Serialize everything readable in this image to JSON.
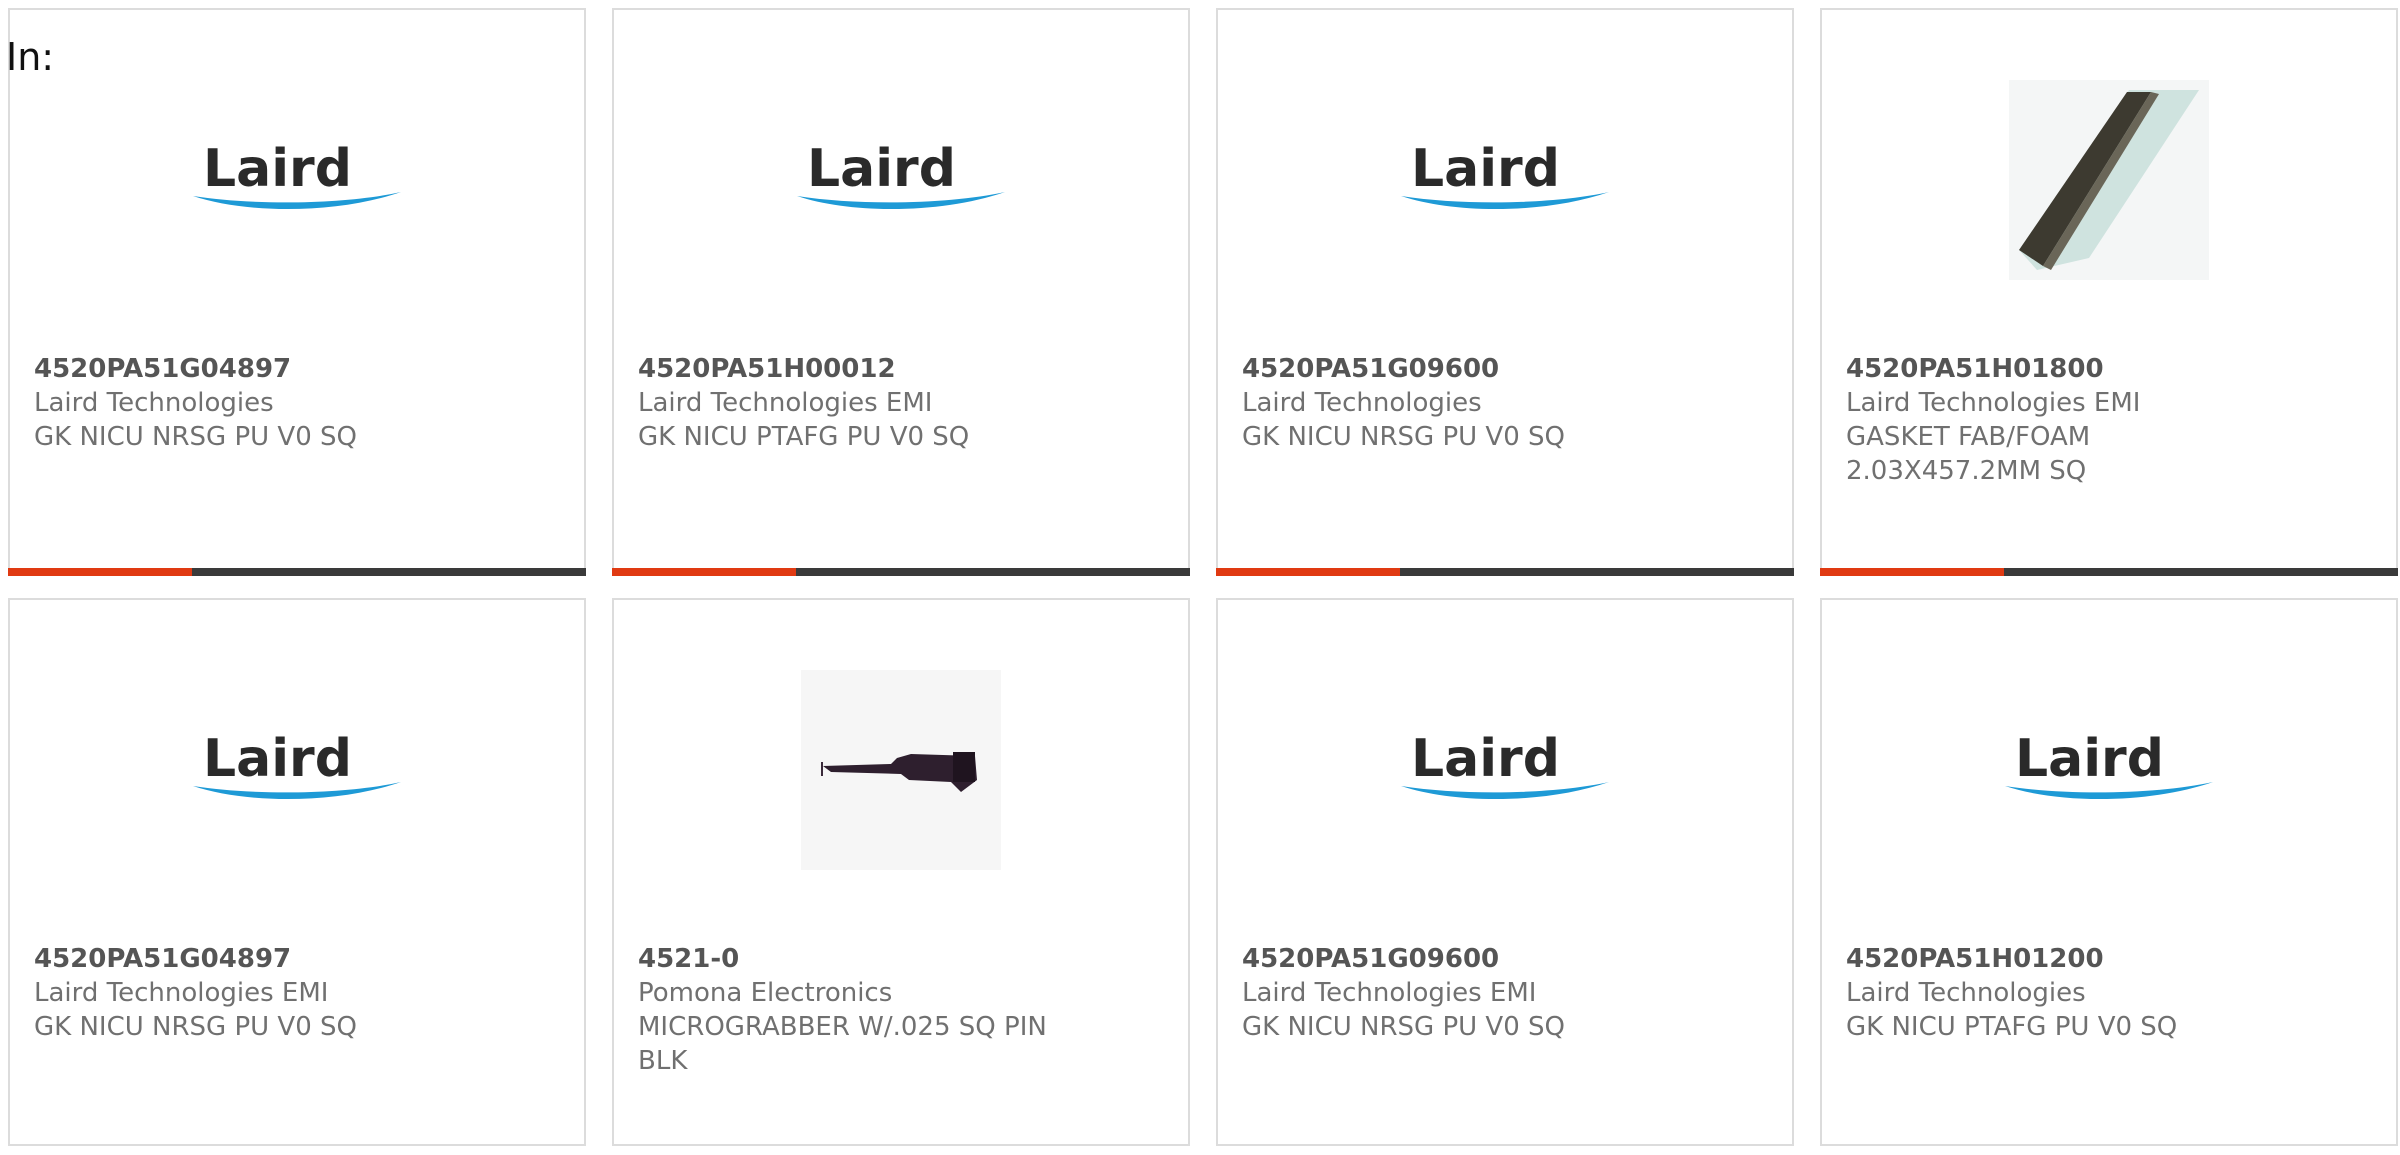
{
  "filter": {
    "label": "In:"
  },
  "colors": {
    "accent": "#e03a12",
    "bar_dark": "#3a3a3a",
    "laird_blue": "#1e9ad6"
  },
  "products": [
    {
      "part_number": "4520PA51G04897",
      "manufacturer": "Laird Technologies",
      "description": "GK NICU NRSG PU V0 SQ",
      "image": "laird-logo"
    },
    {
      "part_number": "4520PA51H00012",
      "manufacturer": "Laird Technologies EMI",
      "description": "GK NICU PTAFG PU V0 SQ",
      "image": "laird-logo"
    },
    {
      "part_number": "4520PA51G09600",
      "manufacturer": "Laird Technologies",
      "description": "GK NICU NRSG PU V0 SQ",
      "image": "laird-logo"
    },
    {
      "part_number": "4520PA51H01800",
      "manufacturer": "Laird Technologies EMI",
      "description": "GASKET FAB/FOAM 2.03X457.2MM SQ",
      "image": "gasket-photo"
    },
    {
      "part_number": "4520PA51G04897",
      "manufacturer": "Laird Technologies EMI",
      "description": "GK NICU NRSG PU V0 SQ",
      "image": "laird-logo"
    },
    {
      "part_number": "4521-0",
      "manufacturer": "Pomona Electronics",
      "description": "MICROGRABBER W/.025 SQ PIN BLK",
      "image": "micrograbber-photo"
    },
    {
      "part_number": "4520PA51G09600",
      "manufacturer": "Laird Technologies EMI",
      "description": "GK NICU NRSG PU V0 SQ",
      "image": "laird-logo"
    },
    {
      "part_number": "4520PA51H01200",
      "manufacturer": "Laird Technologies",
      "description": "GK NICU PTAFG PU V0 SQ",
      "image": "laird-logo"
    }
  ],
  "logo": {
    "text": "Laird"
  }
}
